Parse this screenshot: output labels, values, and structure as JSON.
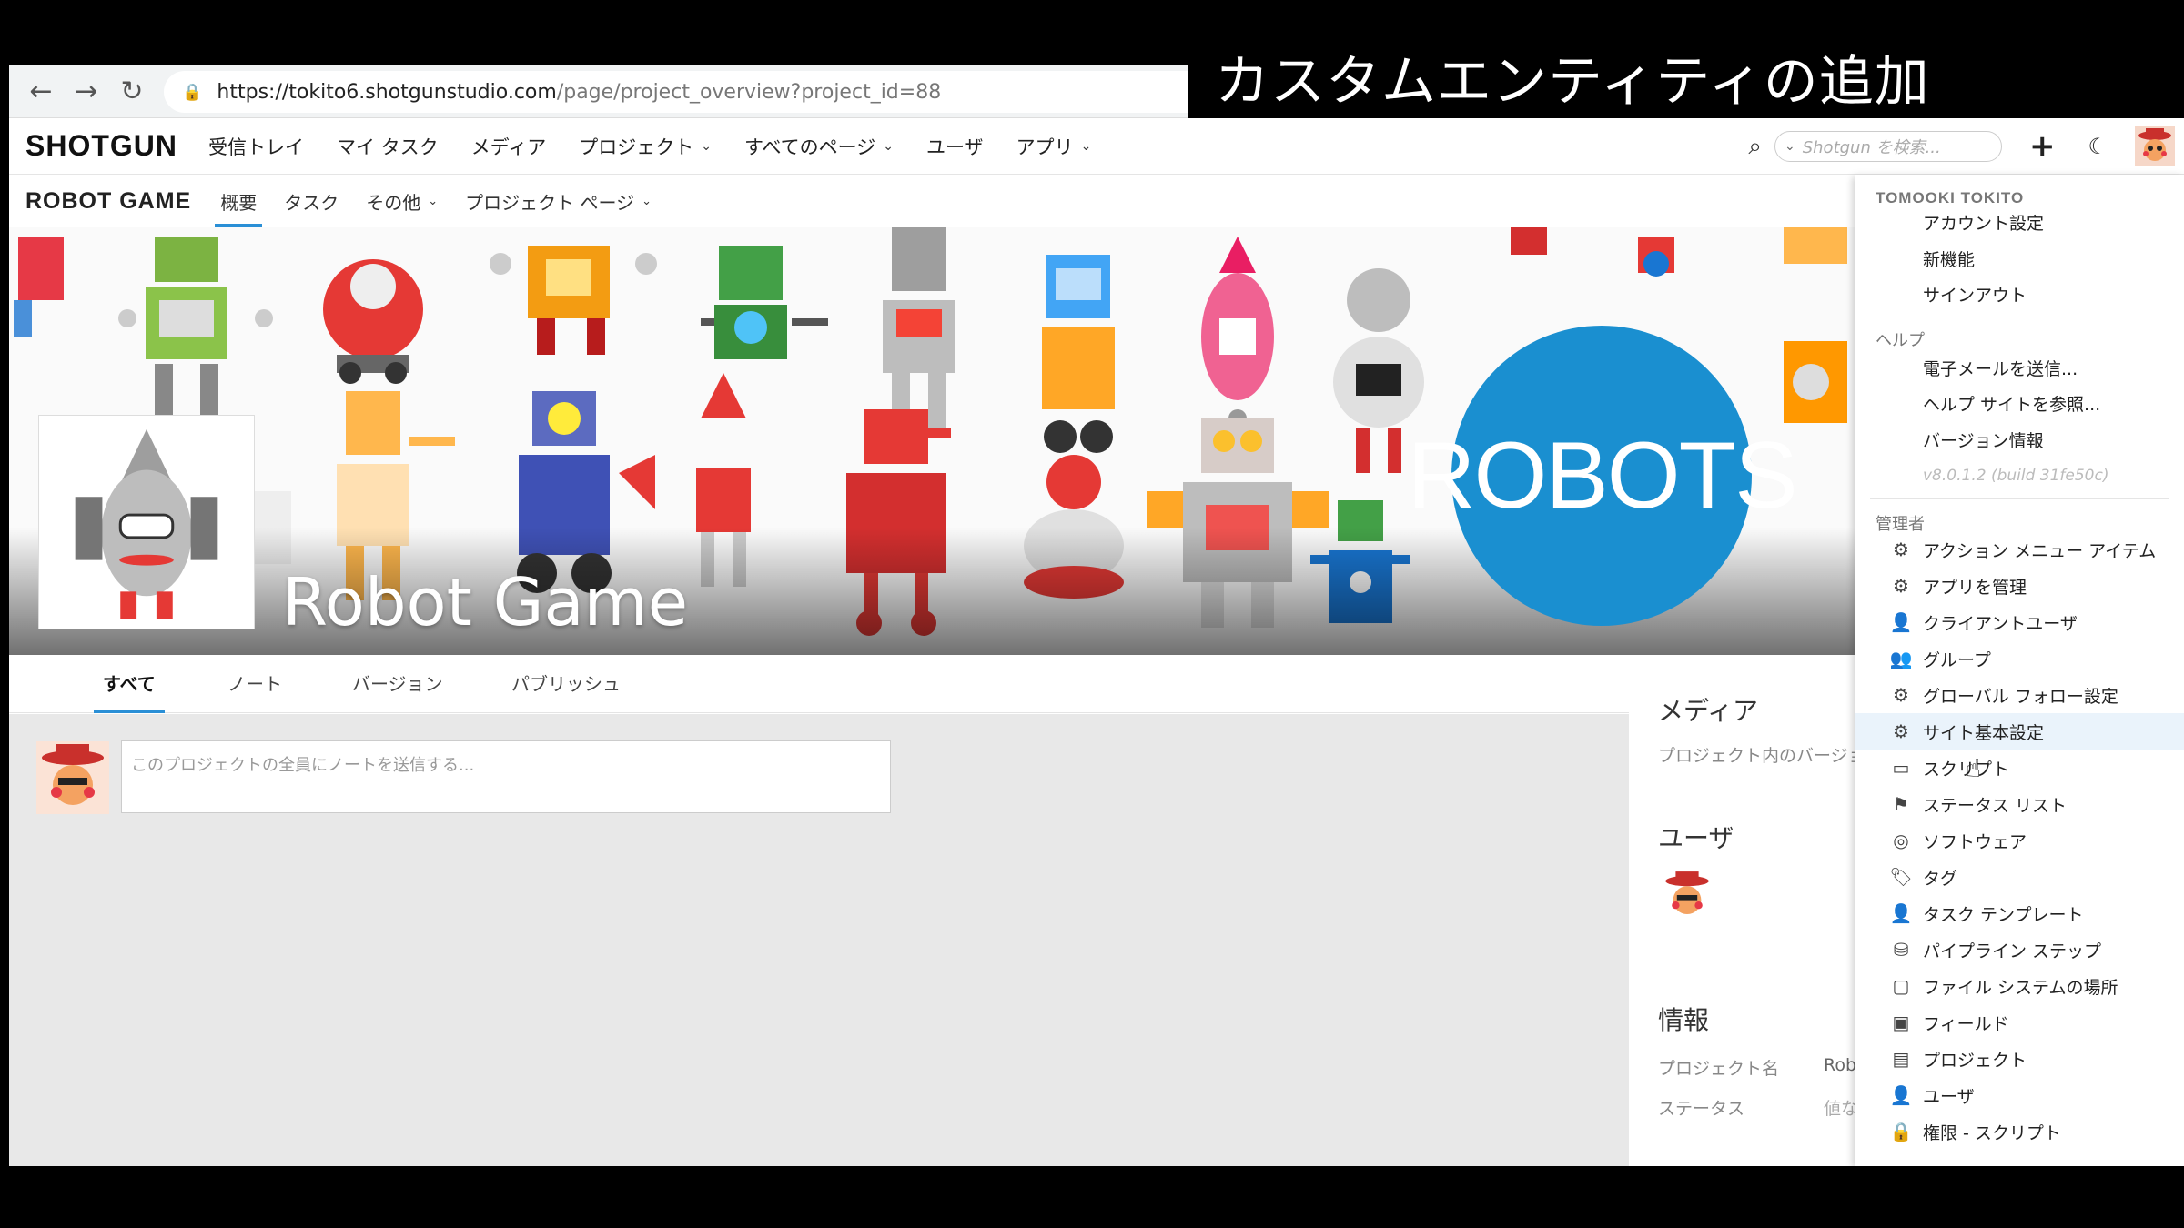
{
  "caption": "カスタムエンティティの追加",
  "browser": {
    "back_icon": "←",
    "forward_icon": "→",
    "reload_icon": "↻",
    "url_host": "https://tokito6.shotgunstudio.com",
    "url_path": "/page/project_overview?project_id=88"
  },
  "header": {
    "logo": "SHOTGUN",
    "nav": [
      "受信トレイ",
      "マイ タスク",
      "メディア",
      "プロジェクト",
      "すべてのページ",
      "ユーザ",
      "アプリ"
    ],
    "search_placeholder": "Shotgun を検索..."
  },
  "project_nav": {
    "title": "ROBOT GAME",
    "tabs": [
      "概要",
      "タスク",
      "その他",
      "プロジェクト ページ"
    ]
  },
  "banner": {
    "project_name": "Robot Game",
    "logo_text": "ROBOTS"
  },
  "activity": {
    "tabs": [
      "すべて",
      "ノート",
      "バージョン",
      "パブリッシュ"
    ],
    "note_placeholder": "このプロジェクトの全員にノートを送信する..."
  },
  "side": {
    "media_title": "メディア",
    "media_text": "プロジェクト内のバージョ",
    "users_title": "ユーザ",
    "info_title": "情報",
    "info_rows": [
      {
        "label": "プロジェクト名",
        "value": "Robo"
      },
      {
        "label": "ステータス",
        "value": "値な"
      }
    ]
  },
  "menu": {
    "user_name": "TOMOOKI TOKITO",
    "account": [
      "アカウント設定",
      "新機能",
      "サインアウト"
    ],
    "help_title": "ヘルプ",
    "help": [
      "電子メールを送信...",
      "ヘルプ サイトを参照...",
      "バージョン情報"
    ],
    "version": "v8.0.1.2 (build 31fe50c)",
    "admin_title": "管理者",
    "admin": [
      {
        "label": "アクション メニュー アイテム",
        "icon": "⚙"
      },
      {
        "label": "アプリを管理",
        "icon": "⚙"
      },
      {
        "label": "クライアントユーザ",
        "icon": "👤"
      },
      {
        "label": "グループ",
        "icon": "👥"
      },
      {
        "label": "グローバル フォロー設定",
        "icon": "⚙"
      },
      {
        "label": "サイト基本設定",
        "icon": "⚙"
      },
      {
        "label": "スクリプト",
        "icon": "▭"
      },
      {
        "label": "ステータス リスト",
        "icon": "⚑"
      },
      {
        "label": "ソフトウェア",
        "icon": "◎"
      },
      {
        "label": "タグ",
        "icon": "🏷"
      },
      {
        "label": "タスク テンプレート",
        "icon": "👤"
      },
      {
        "label": "パイプライン ステップ",
        "icon": "⛁"
      },
      {
        "label": "ファイル システムの場所",
        "icon": "▢"
      },
      {
        "label": "フィールド",
        "icon": "▣"
      },
      {
        "label": "プロジェクト",
        "icon": "▤"
      },
      {
        "label": "ユーザ",
        "icon": "👤"
      },
      {
        "label": "権限 - スクリプト",
        "icon": "🔒"
      }
    ]
  }
}
